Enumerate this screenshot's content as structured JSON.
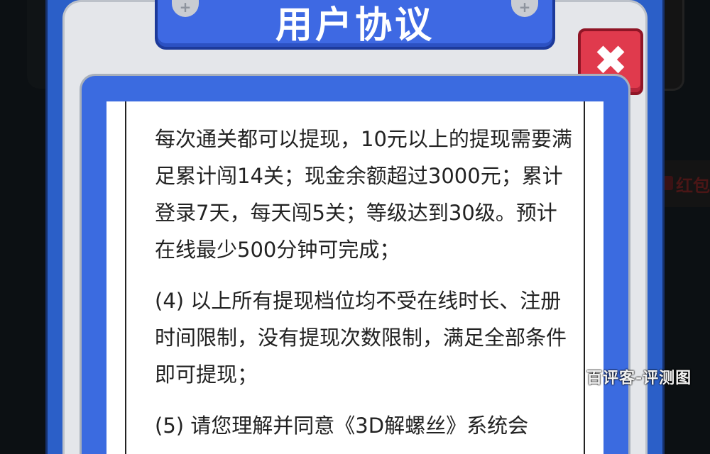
{
  "dialog": {
    "title": "用户协议",
    "close_icon": "close-icon",
    "close_glyph": "✖"
  },
  "agreement": {
    "paragraphs": [
      "每次通关都可以提现，10元以上的提现需要满足累计闯14关；现金余额超过3000元；累计登录7天，每天闯5关；等级达到30级。预计在线最少500分钟可完成；",
      "(4) 以上所有提现档位均不受在线时长、注册时间限制，没有提现次数限制，满足全部条件即可提现；",
      "(5) 请您理解并同意《3D解螺丝》系统会"
    ]
  },
  "background": {
    "redpack_label": "红包"
  },
  "watermark": "百评客-评测图",
  "colors": {
    "dialog_blue": "#3e69e3",
    "close_red": "#e03a4d",
    "frame_gray": "#e4e6ea"
  }
}
